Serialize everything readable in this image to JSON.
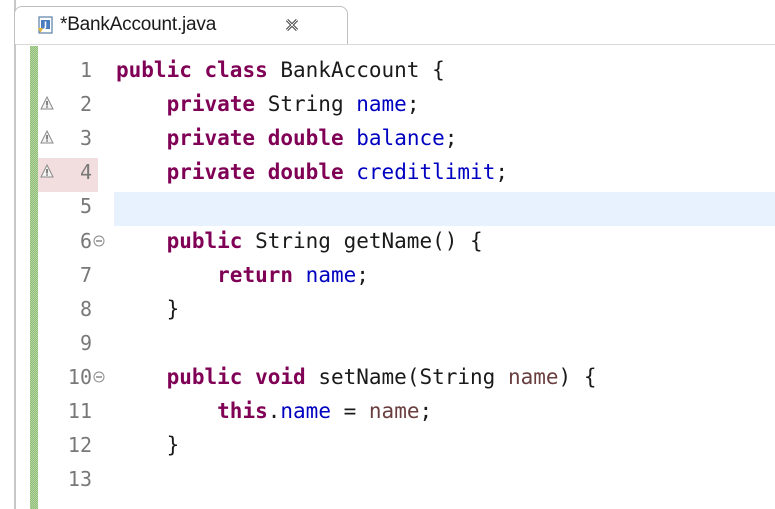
{
  "tab": {
    "title": "*BankAccount.java",
    "file_icon": "java-file-icon",
    "close_icon": "close-tab-icon"
  },
  "colors": {
    "keyword": "#7f0055",
    "field": "#0000c0",
    "parameter": "#6a3e3e",
    "current_line": "#e8f2fe"
  },
  "lines": [
    {
      "num": "1",
      "warn": false,
      "fold": false,
      "tokens": [
        {
          "t": "public",
          "c": "kw"
        },
        {
          "t": " ",
          "c": "plain"
        },
        {
          "t": "class",
          "c": "kw"
        },
        {
          "t": " BankAccount {",
          "c": "plain"
        }
      ]
    },
    {
      "num": "2",
      "warn": true,
      "fold": false,
      "tokens": [
        {
          "t": "    ",
          "c": "plain"
        },
        {
          "t": "private",
          "c": "kw"
        },
        {
          "t": " String ",
          "c": "plain"
        },
        {
          "t": "name",
          "c": "fld"
        },
        {
          "t": ";",
          "c": "plain"
        }
      ]
    },
    {
      "num": "3",
      "warn": true,
      "fold": false,
      "tokens": [
        {
          "t": "    ",
          "c": "plain"
        },
        {
          "t": "private",
          "c": "kw"
        },
        {
          "t": " ",
          "c": "plain"
        },
        {
          "t": "double",
          "c": "kw"
        },
        {
          "t": " ",
          "c": "plain"
        },
        {
          "t": "balance",
          "c": "fld"
        },
        {
          "t": ";",
          "c": "plain"
        }
      ]
    },
    {
      "num": "4",
      "warn": true,
      "fold": false,
      "tokens": [
        {
          "t": "    ",
          "c": "plain"
        },
        {
          "t": "private",
          "c": "kw"
        },
        {
          "t": " ",
          "c": "plain"
        },
        {
          "t": "double",
          "c": "kw"
        },
        {
          "t": " ",
          "c": "plain"
        },
        {
          "t": "creditlimit",
          "c": "fld"
        },
        {
          "t": ";",
          "c": "plain"
        }
      ]
    },
    {
      "num": "5",
      "warn": false,
      "fold": false,
      "tokens": []
    },
    {
      "num": "6",
      "warn": false,
      "fold": true,
      "tokens": [
        {
          "t": "    ",
          "c": "plain"
        },
        {
          "t": "public",
          "c": "kw"
        },
        {
          "t": " String getName() {",
          "c": "plain"
        }
      ]
    },
    {
      "num": "7",
      "warn": false,
      "fold": false,
      "tokens": [
        {
          "t": "        ",
          "c": "plain"
        },
        {
          "t": "return",
          "c": "kw"
        },
        {
          "t": " ",
          "c": "plain"
        },
        {
          "t": "name",
          "c": "fld"
        },
        {
          "t": ";",
          "c": "plain"
        }
      ]
    },
    {
      "num": "8",
      "warn": false,
      "fold": false,
      "tokens": [
        {
          "t": "    }",
          "c": "plain"
        }
      ]
    },
    {
      "num": "9",
      "warn": false,
      "fold": false,
      "tokens": []
    },
    {
      "num": "10",
      "warn": false,
      "fold": true,
      "tokens": [
        {
          "t": "    ",
          "c": "plain"
        },
        {
          "t": "public",
          "c": "kw"
        },
        {
          "t": " ",
          "c": "plain"
        },
        {
          "t": "void",
          "c": "kw"
        },
        {
          "t": " setName(String ",
          "c": "plain"
        },
        {
          "t": "name",
          "c": "prm"
        },
        {
          "t": ") {",
          "c": "plain"
        }
      ]
    },
    {
      "num": "11",
      "warn": false,
      "fold": false,
      "tokens": [
        {
          "t": "        ",
          "c": "plain"
        },
        {
          "t": "this",
          "c": "kw"
        },
        {
          "t": ".",
          "c": "plain"
        },
        {
          "t": "name",
          "c": "fld"
        },
        {
          "t": " = ",
          "c": "plain"
        },
        {
          "t": "name",
          "c": "prm"
        },
        {
          "t": ";",
          "c": "plain"
        }
      ]
    },
    {
      "num": "12",
      "warn": false,
      "fold": false,
      "tokens": [
        {
          "t": "    }",
          "c": "plain"
        }
      ]
    },
    {
      "num": "13",
      "warn": false,
      "fold": false,
      "tokens": []
    }
  ]
}
